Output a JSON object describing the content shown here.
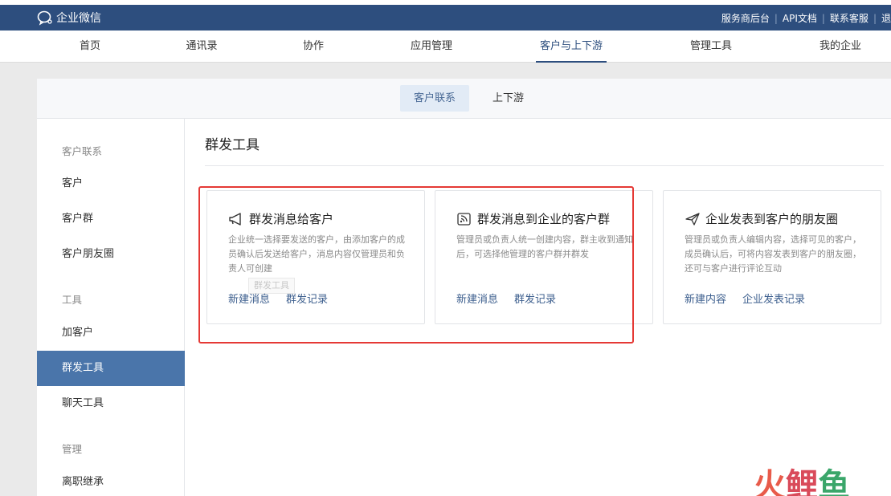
{
  "topbar": {
    "brand": "企业微信",
    "links": [
      "服务商后台",
      "API文档",
      "联系客服",
      "退"
    ]
  },
  "nav": {
    "items": [
      "首页",
      "通讯录",
      "协作",
      "应用管理",
      "客户与上下游",
      "管理工具",
      "我的企业"
    ],
    "active": "客户与上下游"
  },
  "subtabs": {
    "items": [
      "客户联系",
      "上下游"
    ],
    "active": "客户联系"
  },
  "sidebar": {
    "groups": [
      {
        "title": "客户联系",
        "items": [
          "客户",
          "客户群",
          "客户朋友圈"
        ]
      },
      {
        "title": "工具",
        "items": [
          "加客户",
          "群发工具",
          "聊天工具"
        ]
      },
      {
        "title": "管理",
        "items": [
          "离职继承"
        ]
      }
    ],
    "active": "群发工具"
  },
  "content": {
    "title": "群发工具",
    "cards": [
      {
        "icon": "megaphone-icon",
        "title": "群发消息给客户",
        "desc": "企业统一选择要发送的客户，由添加客户的成员确认后发送给客户，消息内容仅管理员和负责人可创建",
        "links": [
          "新建消息",
          "群发记录"
        ]
      },
      {
        "icon": "broadcast-icon",
        "title": "群发消息到企业的客户群",
        "desc": "管理员或负责人统一创建内容，群主收到通知后，可选择他管理的客户群并群发",
        "links": [
          "新建消息",
          "群发记录"
        ]
      },
      {
        "icon": "paper-plane-icon",
        "title": "企业发表到客户的朋友圈",
        "desc": "管理员或负责人编辑内容，选择可见的客户，成员确认后，可将内容发表到客户的朋友圈，还可与客户进行评论互动",
        "links": [
          "新建内容",
          "企业发表记录"
        ]
      }
    ],
    "ghost_tooltip": "群发工具"
  },
  "watermark": [
    "火",
    "鲤",
    "鱼"
  ],
  "colors": {
    "topbar": "#2d4e7e",
    "accent": "#4a75aa",
    "highlight": "#e53935"
  }
}
